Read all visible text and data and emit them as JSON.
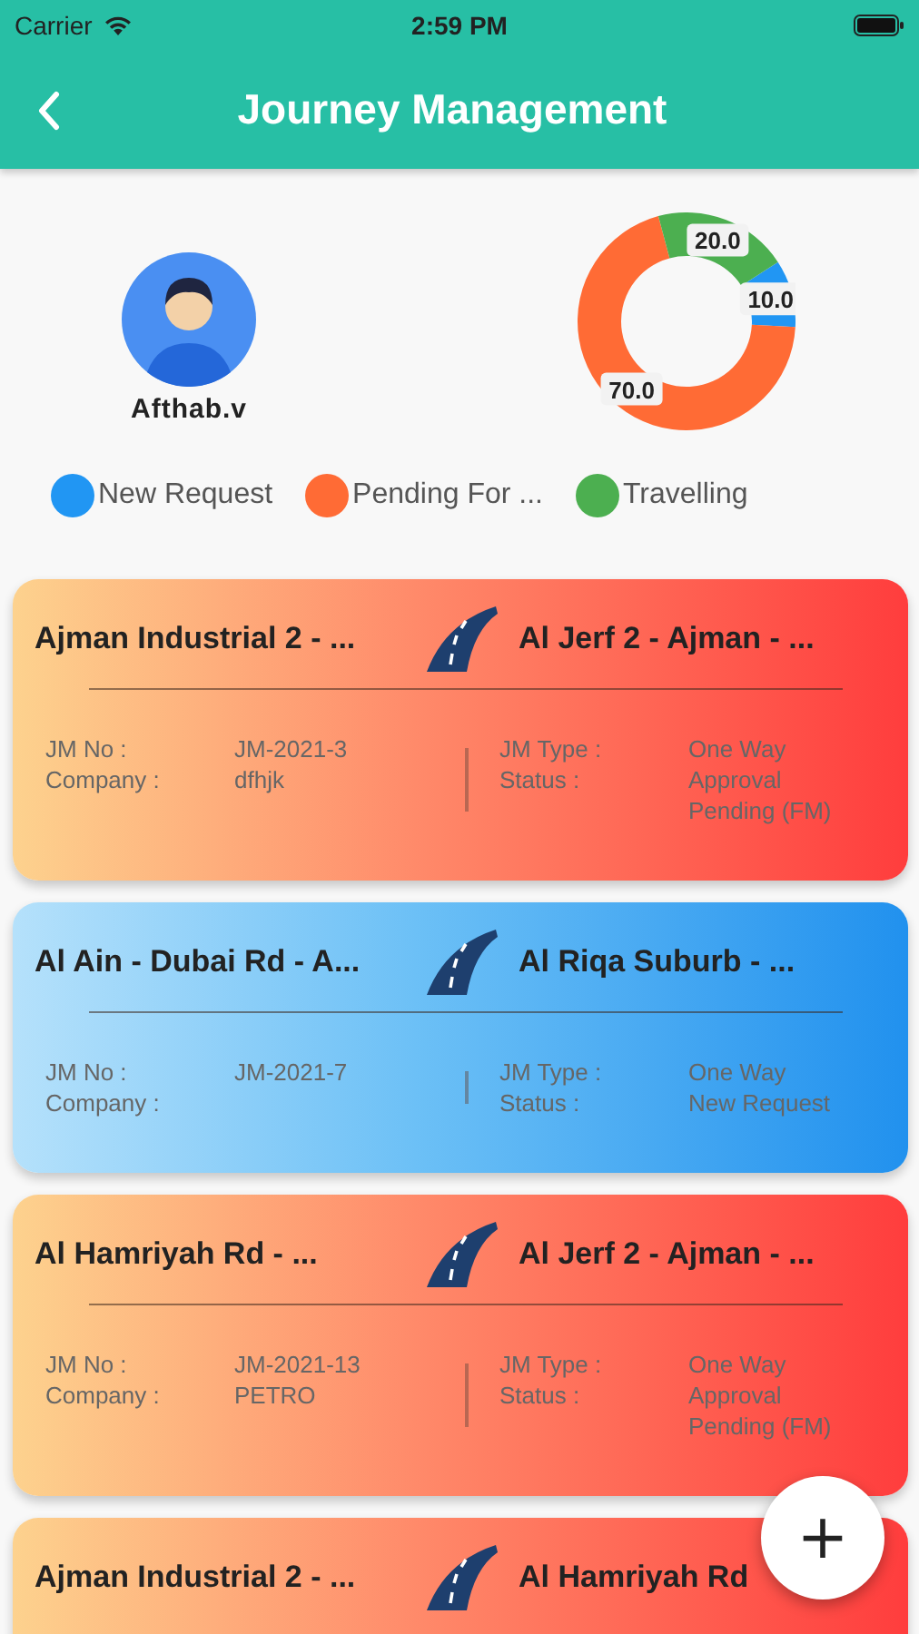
{
  "status_bar": {
    "carrier": "Carrier",
    "time": "2:59 PM"
  },
  "header": {
    "title": "Journey Management"
  },
  "profile": {
    "name": "Afthab.v"
  },
  "summary_chart": {
    "chart_data": {
      "type": "donut",
      "categories": [
        "New Request",
        "Pending For ...",
        "Travelling"
      ],
      "values": [
        10,
        70,
        20
      ],
      "value_labels": [
        "10.0",
        "70.0",
        "20.0"
      ],
      "colors": [
        "#2196f3",
        "#ff6b35",
        "#4caf50"
      ]
    }
  },
  "cards": [
    {
      "kind": "pending",
      "from": "Ajman Industrial 2 - ...",
      "to": "Al Jerf 2 - Ajman - ...",
      "left": [
        {
          "label": "JM No :",
          "value": "JM-2021-3"
        },
        {
          "label": "Company :",
          "value": "dfhjk"
        }
      ],
      "right": [
        {
          "label": "JM Type :",
          "value": "One Way"
        },
        {
          "label": "Status :",
          "value": "Approval Pending (FM)"
        }
      ]
    },
    {
      "kind": "new",
      "from": "Al Ain - Dubai Rd - A...",
      "to": "Al Riqa Suburb - ...",
      "left": [
        {
          "label": "JM No :",
          "value": "JM-2021-7"
        },
        {
          "label": "Company :"
        }
      ],
      "right": [
        {
          "label": "JM Type :",
          "value": "One Way"
        },
        {
          "label": "Status :",
          "value": "New Request"
        }
      ]
    },
    {
      "kind": "pending",
      "from": "Al Hamriyah Rd - ...",
      "to": "Al Jerf 2 - Ajman - ...",
      "left": [
        {
          "label": "JM No :",
          "value": "JM-2021-13"
        },
        {
          "label": "Company :",
          "value": "PETRO"
        }
      ],
      "right": [
        {
          "label": "JM Type :",
          "value": "One Way"
        },
        {
          "label": "Status :",
          "value": "Approval Pending (FM)"
        }
      ]
    },
    {
      "kind": "pending",
      "from": "Ajman Industrial 2 - ...",
      "to": "Al Hamriyah Rd"
    }
  ],
  "add_button": {
    "label": "+"
  }
}
